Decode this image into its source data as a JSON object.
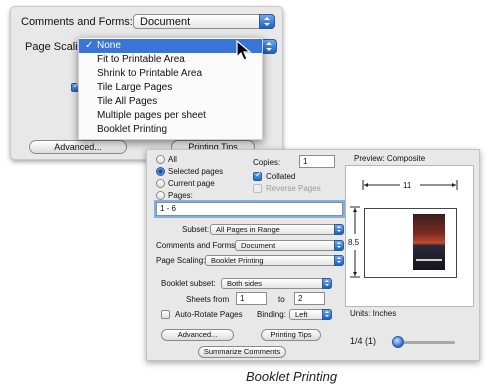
{
  "back_dialog": {
    "comments_label": "Comments and Forms:",
    "comments_value": "Document",
    "page_scaling_label": "Page Scaling",
    "page_scaling_menu": {
      "items": [
        {
          "label": "None",
          "selected": true,
          "check": "✓"
        },
        {
          "label": "Fit to Printable Area",
          "selected": false
        },
        {
          "label": "Shrink to Printable Area",
          "selected": false
        },
        {
          "label": "Tile Large Pages",
          "selected": false
        },
        {
          "label": "Tile All Pages",
          "selected": false
        },
        {
          "label": "Multiple pages per sheet",
          "selected": false
        },
        {
          "label": "Booklet Printing",
          "selected": false
        }
      ]
    },
    "advanced_button": "Advanced...",
    "printing_tips_button": "Printing Tips"
  },
  "front_dialog": {
    "page_range": {
      "all": "All",
      "selected_pages": "Selected pages",
      "current_page": "Current page",
      "pages": "Pages:",
      "selected_option": "Selected pages",
      "pages_value": "1 - 6"
    },
    "copies_label": "Copies:",
    "copies_value": "1",
    "collated_label": "Collated",
    "collated_checked": true,
    "reverse_pages_label": "Reverse Pages",
    "reverse_pages_checked": false,
    "subset_label": "Subset:",
    "subset_value": "All Pages in Range",
    "comments_label": "Comments and Forms:",
    "comments_value": "Document",
    "page_scaling_label": "Page Scaling:",
    "page_scaling_value": "Booklet Printing",
    "booklet_subset_label": "Booklet subset:",
    "booklet_subset_value": "Both sides",
    "sheets_from_label": "Sheets from",
    "sheets_from_value": "1",
    "sheets_to_label": "to",
    "sheets_to_value": "2",
    "auto_rotate_label": "Auto-Rotate Pages",
    "auto_rotate_checked": false,
    "binding_label": "Binding:",
    "binding_value": "Left",
    "advanced_button": "Advanced...",
    "printing_tips_button": "Printing Tips",
    "summarize_button": "Summarize Comments",
    "preview": {
      "title": "Preview: Composite",
      "width_label": "11",
      "height_label": "8.5",
      "units": "Units: Inches",
      "page_counter": "1/4 (1)"
    }
  },
  "caption": "Booklet Printing",
  "colors": {
    "selection": "#3875d7",
    "panel": "#e8e8e8",
    "aqua_blue": "#2a66c4"
  }
}
